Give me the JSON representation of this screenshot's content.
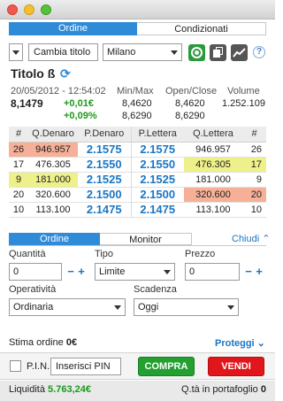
{
  "tabs": {
    "ordine": "Ordine",
    "condizionati": "Condizionati"
  },
  "search": {
    "title_value": "Cambia titolo",
    "market_value": "Milano"
  },
  "icons": {
    "help": "?",
    "refresh": "⟳"
  },
  "instrument": {
    "name": "Titolo ß",
    "datetime": "20/05/2012 - 12:54:02",
    "price": "8,1479",
    "change_abs": "+0,01€",
    "change_pct": "+0,09%",
    "headers": {
      "minmax": "Min/Max",
      "openclose": "Open/Close",
      "volume": "Volume"
    },
    "min": "8,4620",
    "max": "8,6290",
    "open": "8,4620",
    "close": "8,6290",
    "volume": "1.252.109"
  },
  "book": {
    "headers": [
      "#",
      "Q.Denaro",
      "P.Denaro",
      "P.Lettera",
      "Q.Lettera",
      "#"
    ],
    "rows": [
      [
        "26",
        "946.957",
        "2.1575",
        "2.1575",
        "946.957",
        "26"
      ],
      [
        "17",
        "476.305",
        "2.1550",
        "2.1550",
        "476.305",
        "17"
      ],
      [
        "9",
        "181.000",
        "2.1525",
        "2.1525",
        "181.000",
        "9"
      ],
      [
        "20",
        "320.600",
        "2.1500",
        "2.1500",
        "320.600",
        "20"
      ],
      [
        "10",
        "113.100",
        "2.1475",
        "2.1475",
        "113.100",
        "10"
      ]
    ]
  },
  "order_tabs": {
    "ordine": "Ordine",
    "monitor": "Monitor",
    "chiudi": "Chiudi"
  },
  "form": {
    "quantita_label": "Quantità",
    "quantita_value": "0",
    "tipo_label": "Tipo",
    "tipo_value": "Limite",
    "prezzo_label": "Prezzo",
    "prezzo_value": "0",
    "operativita_label": "Operatività",
    "operativita_value": "Ordinaria",
    "scadenza_label": "Scadenza",
    "scadenza_value": "Oggi"
  },
  "stima": {
    "label": "Stima ordine",
    "value": "0€",
    "proteggi": "Proteggi"
  },
  "pin": {
    "label": "P.I.N.",
    "placeholder": "Inserisci PIN"
  },
  "buttons": {
    "compra": "COMPRA",
    "vendi": "VENDI"
  },
  "footer": {
    "liquidita_label": "Liquidità",
    "liquidita_value": "5.763,24€",
    "qta_label": "Q.tà in portafoglio",
    "qta_value": "0"
  }
}
